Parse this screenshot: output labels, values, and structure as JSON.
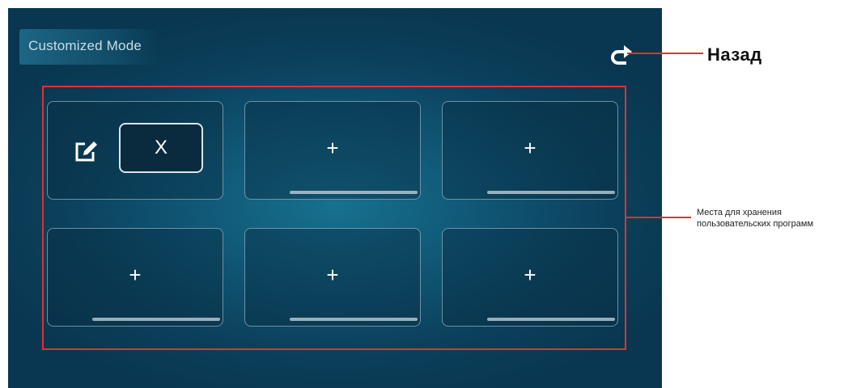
{
  "header": {
    "title": "Customized Mode"
  },
  "back_button": {
    "icon": "redo-arrow-icon"
  },
  "slots": [
    {
      "type": "editable",
      "edit_icon": "edit-icon",
      "delete_label": "X"
    },
    {
      "type": "empty",
      "label": "+"
    },
    {
      "type": "empty",
      "label": "+"
    },
    {
      "type": "empty",
      "label": "+"
    },
    {
      "type": "empty",
      "label": "+"
    },
    {
      "type": "empty",
      "label": "+"
    }
  ],
  "annotations": {
    "back_label": "Назад",
    "slots_label_line1": "Места для хранения",
    "slots_label_line2": "пользовательских программ",
    "color": "#e0322f"
  },
  "colors": {
    "screen_bg": "#0b3f5a",
    "screen_glow": "#17718f",
    "slot_border": "#8cafbe",
    "accent_red": "#e0322f"
  }
}
